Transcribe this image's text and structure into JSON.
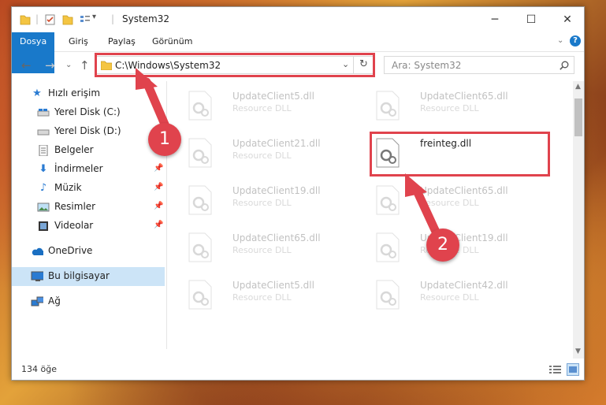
{
  "window": {
    "title": "System32",
    "quick_access_dropdown": "▾"
  },
  "ribbon": {
    "tabs": [
      "Dosya",
      "Giriş",
      "Paylaş",
      "Görünüm"
    ]
  },
  "address_bar": {
    "path": "C:\\Windows\\System32",
    "search_placeholder": "Ara: System32"
  },
  "sidebar": {
    "items": [
      {
        "label": "Hızlı erişim",
        "icon": "star-icon",
        "pinned": false
      },
      {
        "label": "Yerel Disk (C:)",
        "icon": "drive-icon",
        "pinned": false
      },
      {
        "label": "Yerel Disk (D:)",
        "icon": "drive-icon",
        "pinned": false
      },
      {
        "label": "Belgeler",
        "icon": "document-icon",
        "pinned": true
      },
      {
        "label": "İndirmeler",
        "icon": "download-icon",
        "pinned": true
      },
      {
        "label": "Müzik",
        "icon": "music-icon",
        "pinned": true
      },
      {
        "label": "Resimler",
        "icon": "pictures-icon",
        "pinned": true
      },
      {
        "label": "Videolar",
        "icon": "video-icon",
        "pinned": true
      },
      {
        "label": "OneDrive",
        "icon": "cloud-icon",
        "pinned": false
      },
      {
        "label": "Bu bilgisayar",
        "icon": "computer-icon",
        "pinned": false,
        "selected": true
      },
      {
        "label": "Ağ",
        "icon": "network-icon",
        "pinned": false
      }
    ]
  },
  "files": [
    {
      "name": "UpdateClient5.dll",
      "type": "Resource DLL",
      "faded": true
    },
    {
      "name": "UpdateClient65.dll",
      "type": "Resource DLL",
      "faded": true
    },
    {
      "name": "UpdateClient21.dll",
      "type": "Resource DLL",
      "faded": true
    },
    {
      "name": "freinteg.dll",
      "type": "",
      "faded": false
    },
    {
      "name": "UpdateClient19.dll",
      "type": "Resource DLL",
      "faded": true
    },
    {
      "name": "UpdateClient65.dll",
      "type": "Resource DLL",
      "faded": true
    },
    {
      "name": "UpdateClient65.dll",
      "type": "Resource DLL",
      "faded": true
    },
    {
      "name": "UpdateClient19.dll",
      "type": "Resource DLL",
      "faded": true
    },
    {
      "name": "UpdateClient5.dll",
      "type": "Resource DLL",
      "faded": true
    },
    {
      "name": "UpdateClient42.dll",
      "type": "Resource DLL",
      "faded": true
    }
  ],
  "status": {
    "item_count": "134 öğe"
  },
  "annotations": {
    "step1": "1",
    "step2": "2",
    "color": "#e0434d"
  },
  "colors": {
    "accent": "#1979ca",
    "selection": "#cce4f7"
  }
}
